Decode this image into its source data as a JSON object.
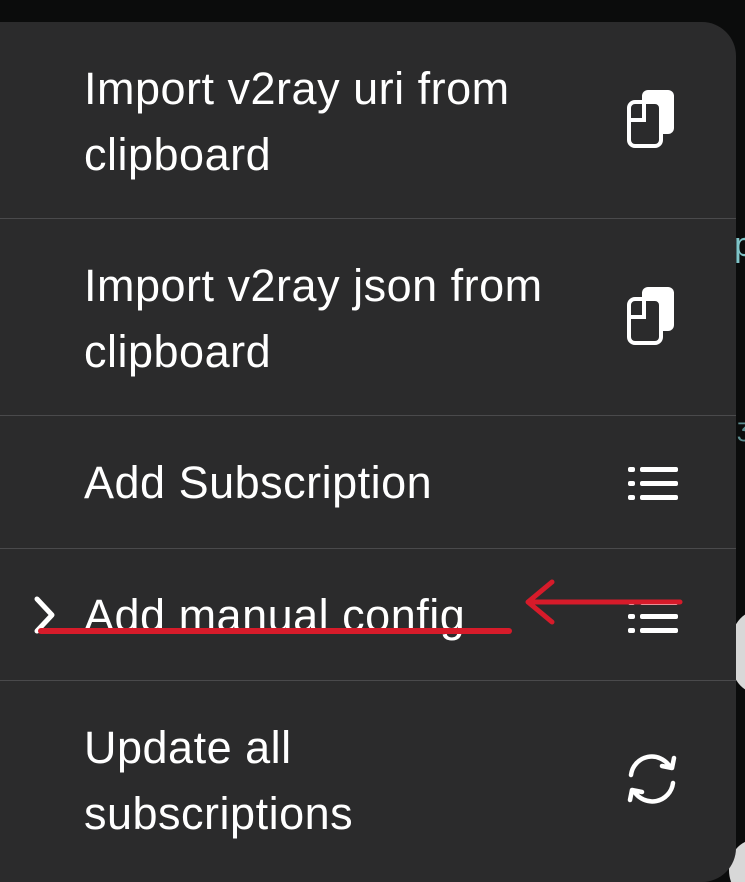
{
  "menu": {
    "items": [
      {
        "label": "Import v2ray uri from\nclipboard",
        "icon": "clipboard-copy-icon"
      },
      {
        "label": "Import v2ray json from\nclipboard",
        "icon": "clipboard-copy-icon"
      },
      {
        "label": "Add Subscription",
        "icon": "list-icon"
      },
      {
        "label": "Add manual config",
        "icon": "list-icon",
        "selected": true
      },
      {
        "label": "Update all\nsubscriptions",
        "icon": "refresh-icon"
      }
    ]
  },
  "annotation": {
    "color": "#d61b2a",
    "arrow_target": "Add manual config"
  },
  "colors": {
    "menu_background": "#2b2b2c",
    "text": "#ffffff",
    "divider": "#4a4a4c",
    "background_accent": "#7fc4c8"
  }
}
